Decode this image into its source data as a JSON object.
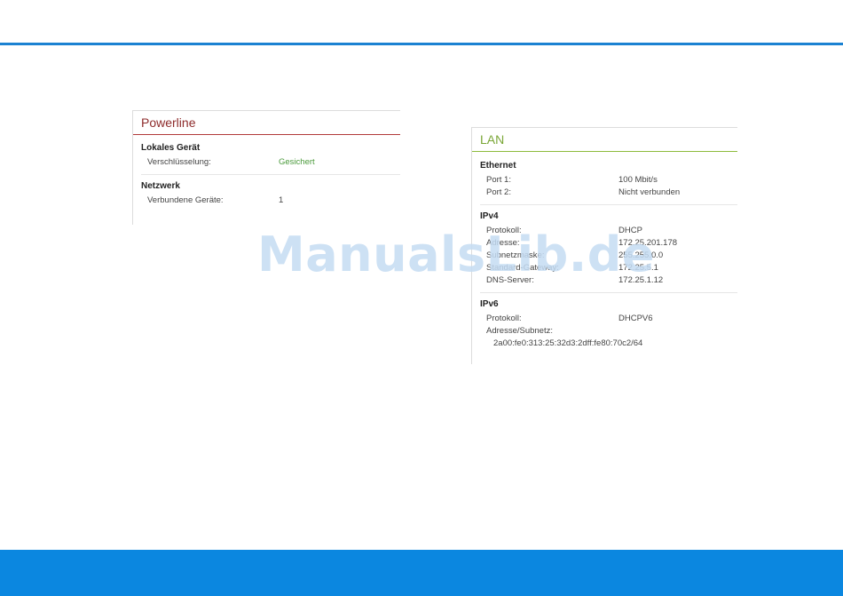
{
  "powerline": {
    "title": "Powerline",
    "local_device": {
      "heading": "Lokales Gerät",
      "rows": [
        {
          "label": "Verschlüsselung:",
          "value": "Gesichert"
        }
      ]
    },
    "network": {
      "heading": "Netzwerk",
      "rows": [
        {
          "label": "Verbundene Geräte:",
          "value": "1"
        }
      ]
    }
  },
  "lan": {
    "title": "LAN",
    "ethernet": {
      "heading": "Ethernet",
      "rows": [
        {
          "label": "Port 1:",
          "value": "100 Mbit/s"
        },
        {
          "label": "Port 2:",
          "value": "Nicht verbunden"
        }
      ]
    },
    "ipv4": {
      "heading": "IPv4",
      "rows": [
        {
          "label": "Protokoll:",
          "value": "DHCP"
        },
        {
          "label": "Adresse:",
          "value": "172.25.201.178"
        },
        {
          "label": "Subnetzmaske:",
          "value": "255.255.0.0"
        },
        {
          "label": "Standard-Gateway:",
          "value": "172.25.5.1"
        },
        {
          "label": "DNS-Server:",
          "value": "172.25.1.12"
        }
      ]
    },
    "ipv6": {
      "heading": "IPv6",
      "rows": [
        {
          "label": "Protokoll:",
          "value": "DHCPV6"
        },
        {
          "label": "Adresse/Subnetz:",
          "value": ""
        }
      ],
      "address_value": "2a00:fe0:313:25:32d3:2dff:fe80:70c2/64"
    }
  },
  "watermark": "ManualsLib.de",
  "colors": {
    "accent_blue": "#1b82d2",
    "footer_blue": "#0b87e0",
    "powerline_red": "#b13a3a",
    "lan_green": "#8dbb3c",
    "status_ok": "#4a9a3b"
  }
}
